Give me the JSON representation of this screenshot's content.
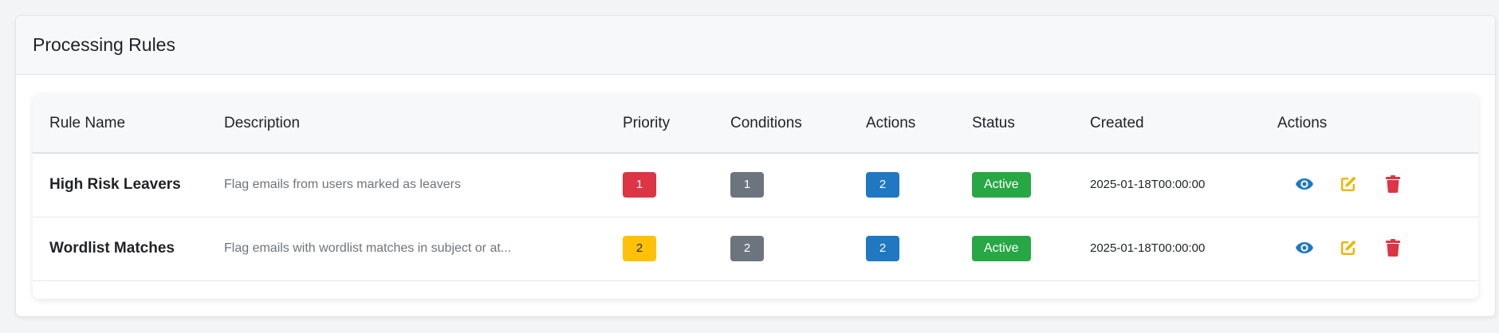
{
  "card": {
    "title": "Processing Rules"
  },
  "table": {
    "headers": [
      "Rule Name",
      "Description",
      "Priority",
      "Conditions",
      "Actions",
      "Status",
      "Created",
      "Actions"
    ],
    "rows": [
      {
        "name": "High Risk Leavers",
        "description": "Flag emails from users marked as leavers",
        "priority": "1",
        "priority_color": "#dc3545",
        "conditions": "1",
        "actions_count": "2",
        "status": "Active",
        "created": "2025-01-18T00:00:00"
      },
      {
        "name": "Wordlist Matches",
        "description": "Flag emails with wordlist matches in subject or at...",
        "priority": "2",
        "priority_color": "#ffc107",
        "conditions": "2",
        "actions_count": "2",
        "status": "Active",
        "created": "2025-01-18T00:00:00"
      }
    ]
  },
  "icons": {
    "view": "eye-icon",
    "edit": "edit-icon",
    "delete": "trash-icon"
  },
  "colors": {
    "danger": "#dc3545",
    "warning": "#ffc107",
    "secondary": "#6c757d",
    "primary": "#1f78c1",
    "success": "#28a745",
    "view_icon": "#1f78c1",
    "edit_icon": "#f0b400",
    "delete_icon": "#dc3545"
  }
}
